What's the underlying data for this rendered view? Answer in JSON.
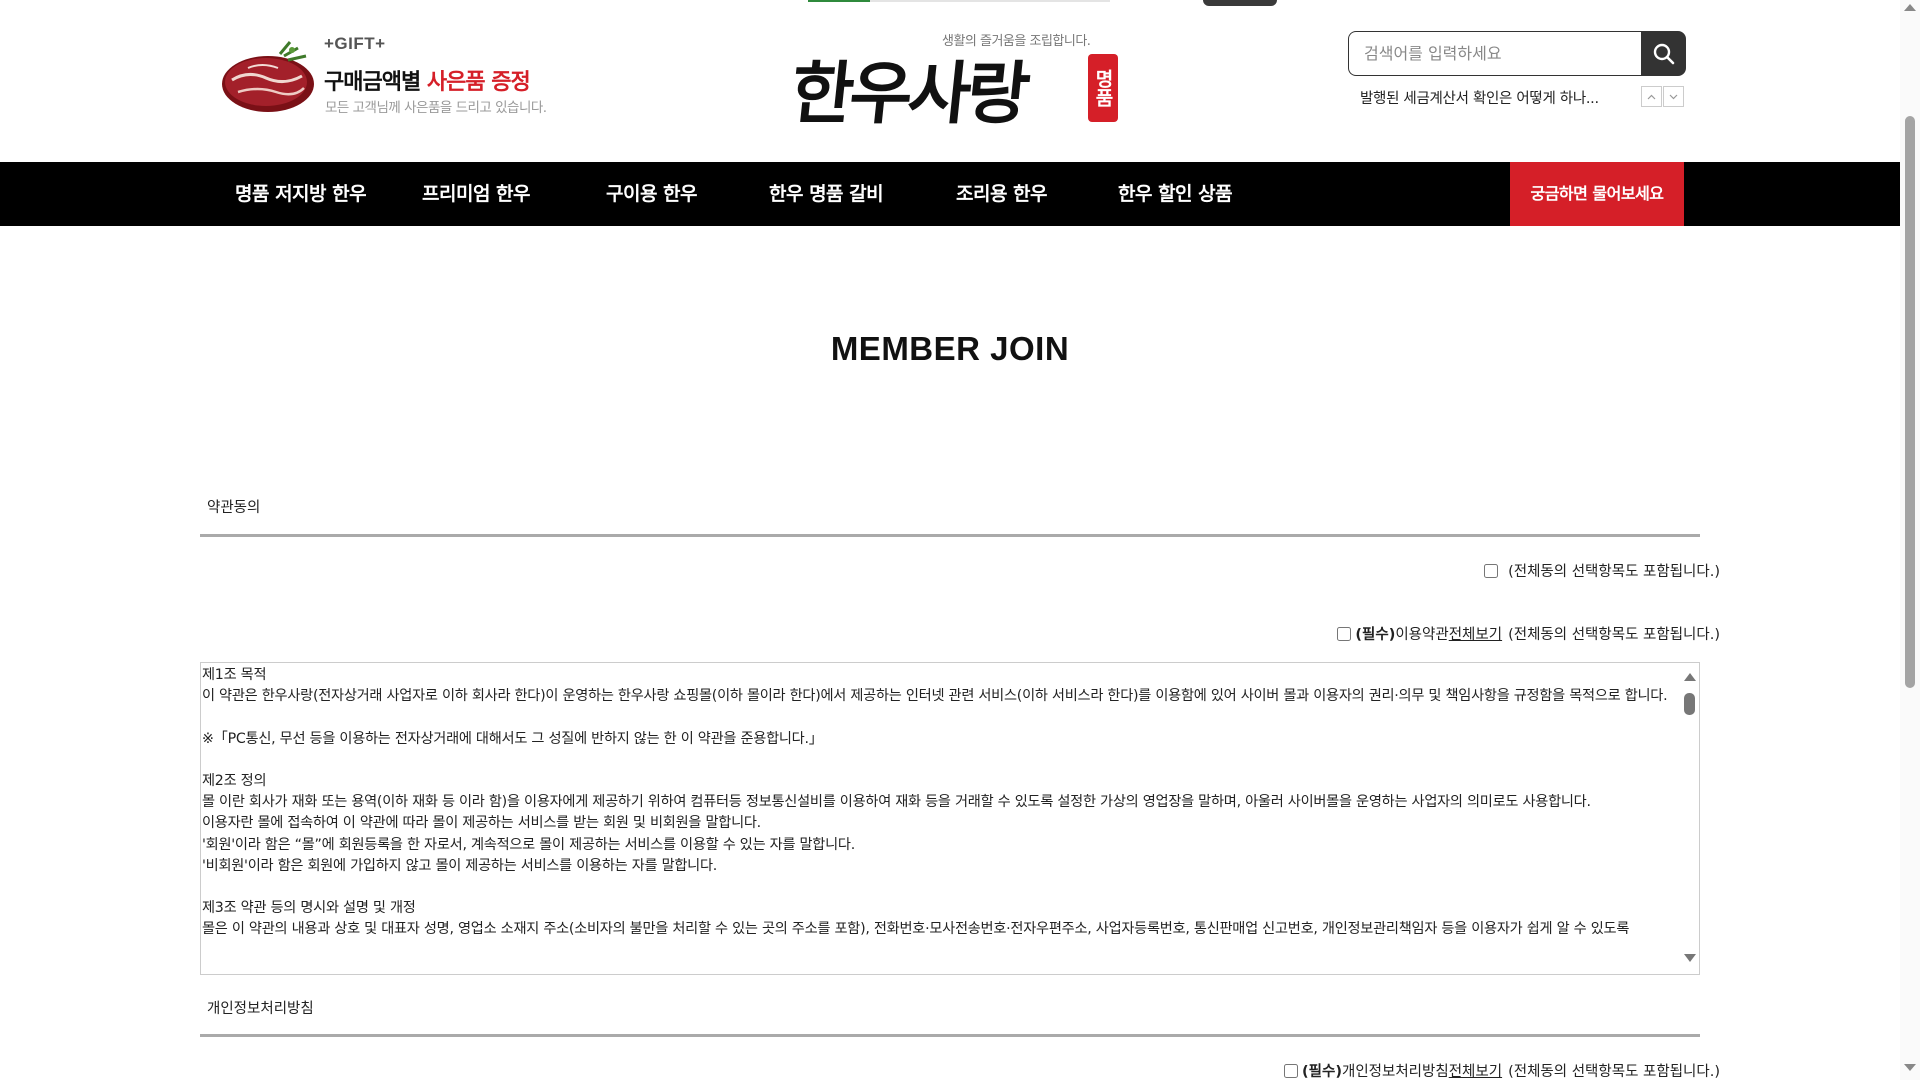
{
  "header": {
    "gift": {
      "tag": "+GIFT+",
      "title_prefix": "구매금액별 ",
      "title_highlight": "사은품 증정",
      "subtitle": "모든 고객님께 사은품을 드리고 있습니다."
    },
    "logo": {
      "tagline": "생활의 즐거움을 조립합니다.",
      "name": "한우사랑",
      "seal": "명품"
    },
    "search": {
      "placeholder": "검색어를 입력하세요"
    },
    "notice": "발행된 세금계산서 확인은 어떻게 하나..."
  },
  "nav": {
    "items": [
      {
        "label": "명품 저지방 한우"
      },
      {
        "label": "프리미엄 한우"
      },
      {
        "label": "구이용 한우"
      },
      {
        "label": "한우 명품 갈비"
      },
      {
        "label": "조리용 한우"
      },
      {
        "label": "한우 할인 상품"
      }
    ],
    "cta": "궁금하면 물어보세요"
  },
  "page": {
    "title": "MEMBER JOIN"
  },
  "terms": {
    "section_label": "약관동의",
    "all_agree_note": "(전체동의 선택항목도 포함됩니다.)",
    "agreement1": {
      "required": "(필수)",
      "name": "이용약관",
      "view_all": "전체보기",
      "note": "(전체동의 선택항목도 포함됩니다.)"
    },
    "content": "제1조 목적\n이 약관은 한우사랑(전자상거래 사업자로 이하 회사라 한다)이 운영하는 한우사랑 쇼핑몰(이하 몰이라 한다)에서 제공하는 인터넷 관련 서비스(이하 서비스라 한다)를 이용함에 있어 사이버 몰과 이용자의 권리·의무 및 책임사항을 규정함을 목적으로 합니다.\n\n※「PC통신, 무선 등을 이용하는 전자상거래에 대해서도 그 성질에 반하지 않는 한 이 약관을 준용합니다.」\n\n제2조 정의\n몰 이란 회사가 재화 또는 용역(이하 재화 등 이라 함)을 이용자에게 제공하기 위하여 컴퓨터등 정보통신설비를 이용하여 재화 등을 거래할 수 있도록 설정한 가상의 영업장을 말하며, 아울러 사이버몰을 운영하는 사업자의 의미로도 사용합니다.\n이용자란 몰에 접속하여 이 약관에 따라 몰이 제공하는 서비스를 받는 회원 및 비회원을 말합니다.\n'회원'이라 함은 “몰”에 회원등록을 한 자로서, 계속적으로 몰이 제공하는 서비스를 이용할 수 있는 자를 말합니다.\n'비회원'이라 함은 회원에 가입하지 않고 몰이 제공하는 서비스를 이용하는 자를 말합니다.\n\n제3조 약관 등의 명시와 설명 및 개정\n몰은 이 약관의 내용과 상호 및 대표자 성명, 영업소 소재지 주소(소비자의 불만을 처리할 수 있는 곳의 주소를 포함), 전화번호·모사전송번호·전자우편주소, 사업자등록번호, 통신판매업 신고번호, 개인정보관리책임자 등을 이용자가 쉽게 알 수 있도록"
  },
  "privacy": {
    "section_label": "개인정보처리방침",
    "agreement": {
      "required": "(필수)",
      "name": "개인정보처리방침",
      "view_all": "전체보기",
      "note": "(전체동의 선택항목도 포함됩니다.)"
    }
  }
}
